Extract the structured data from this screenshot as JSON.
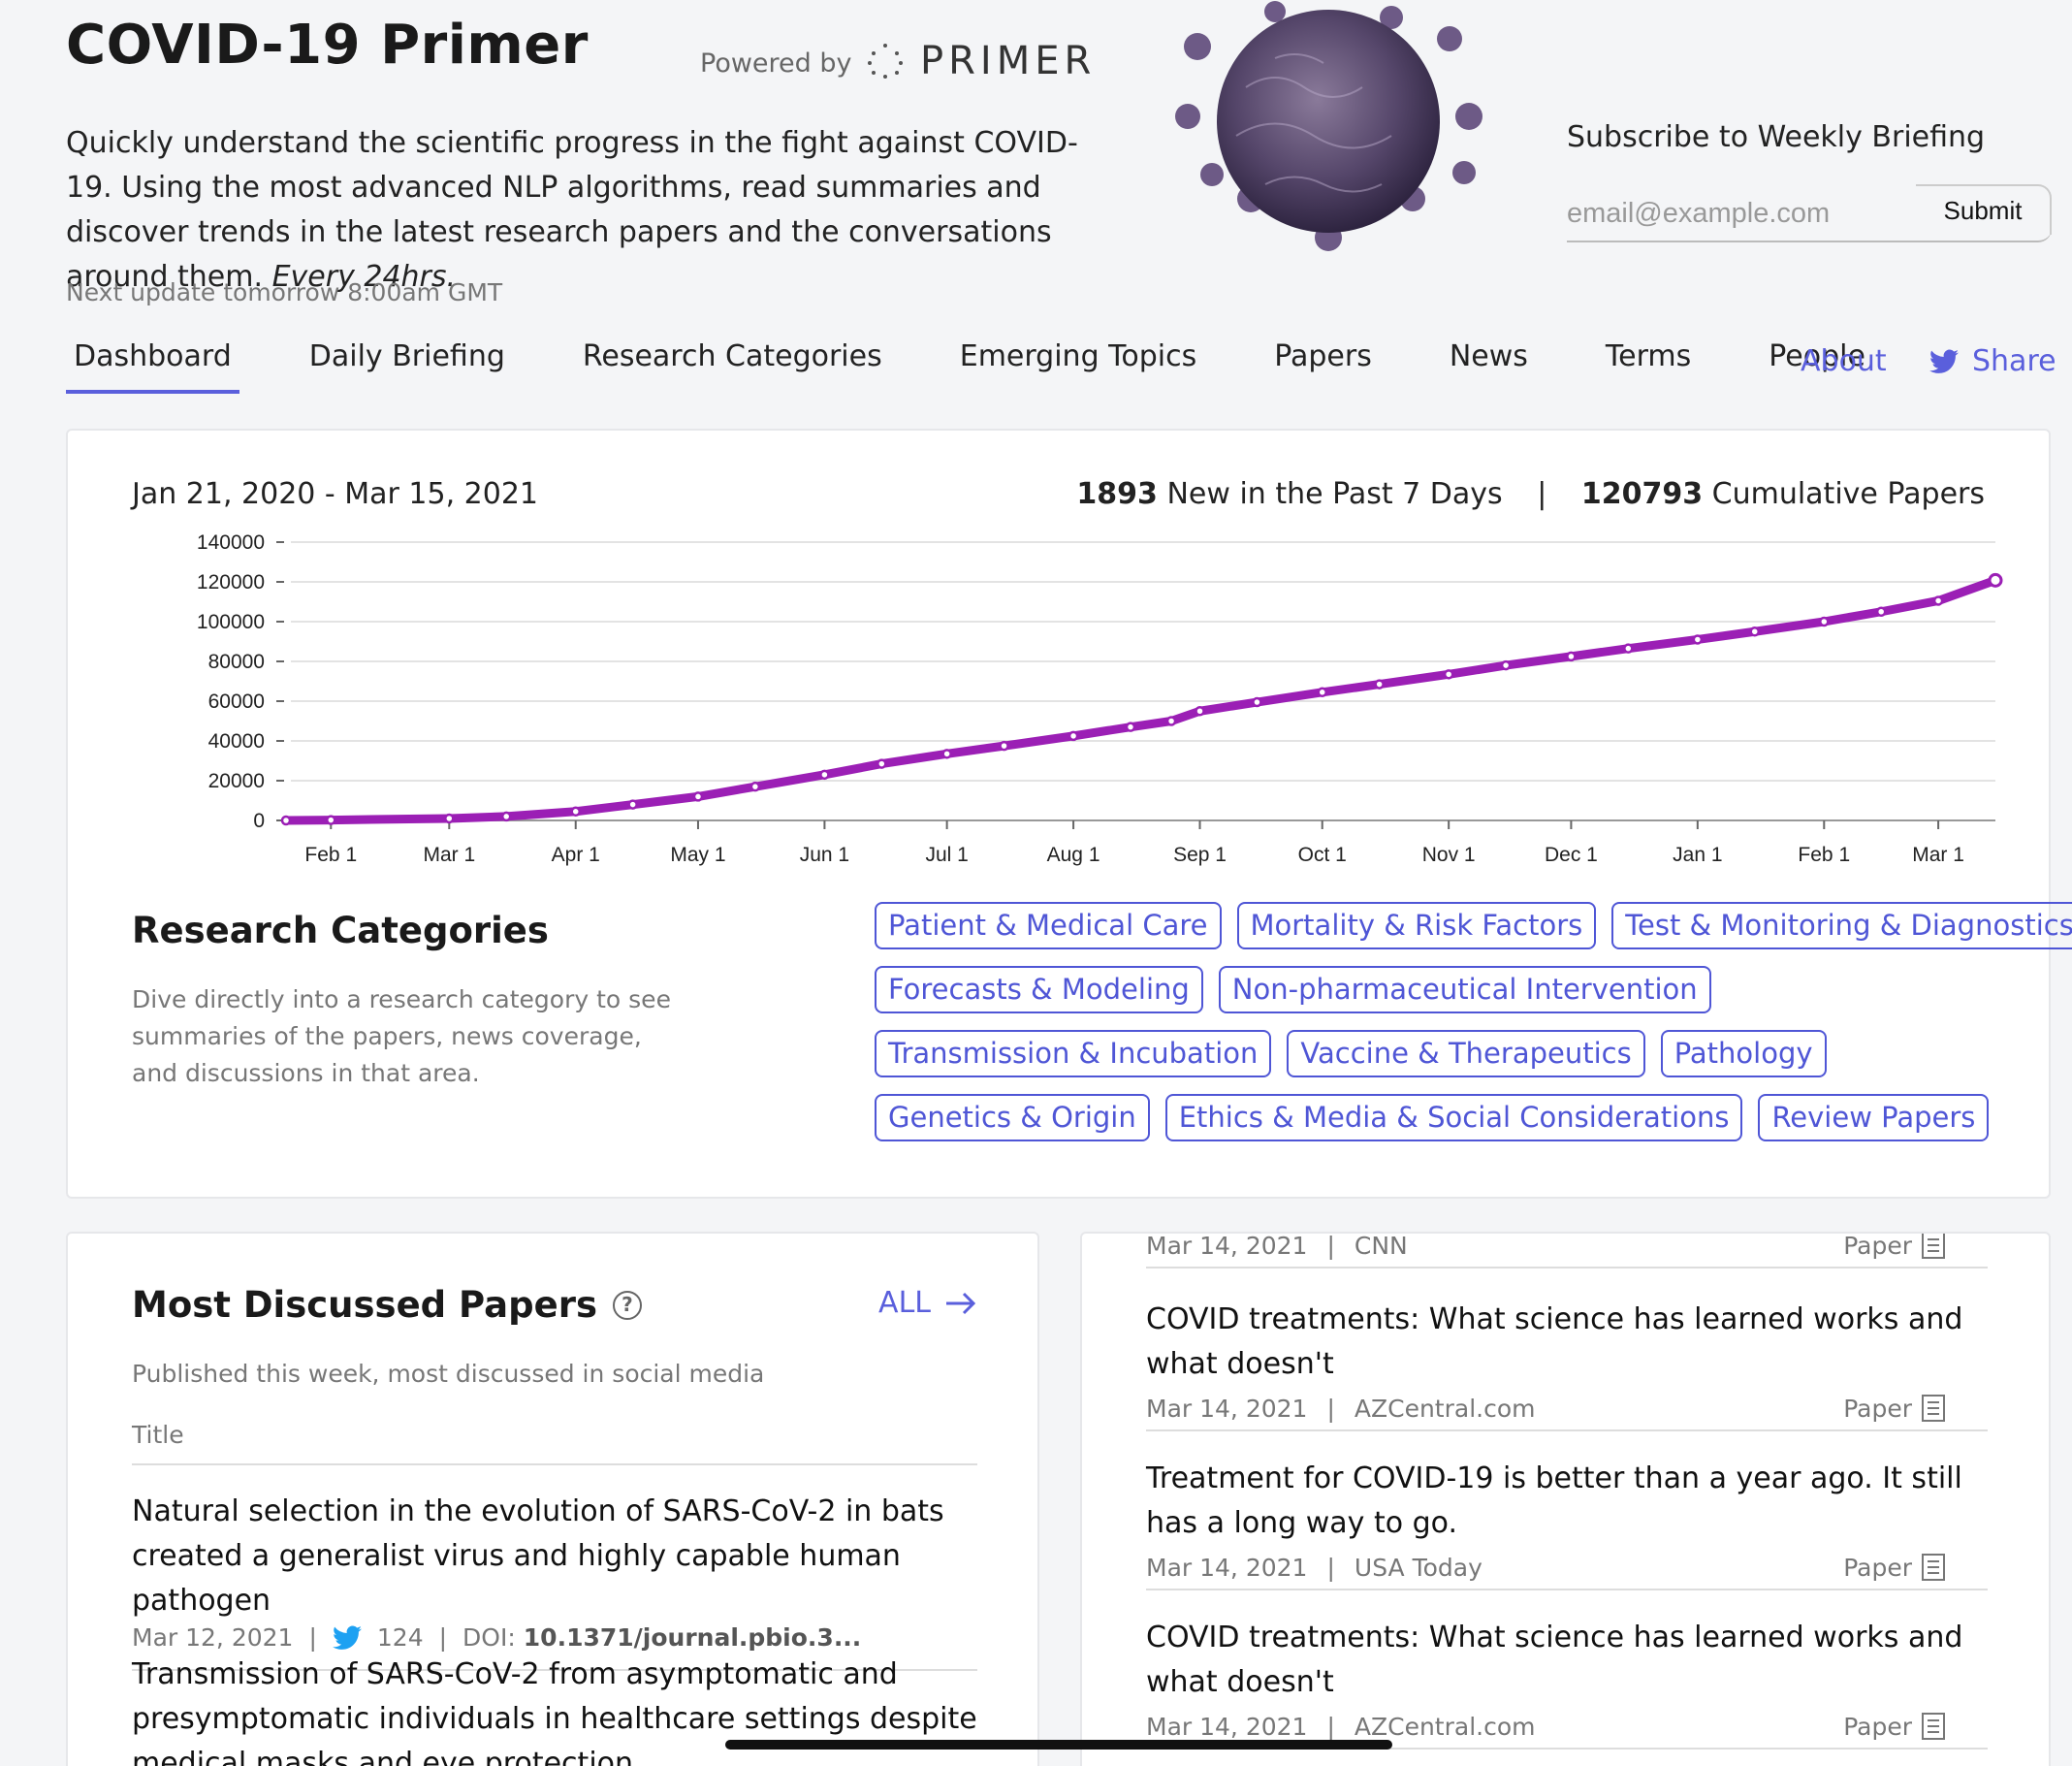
{
  "header": {
    "title": "COVID-19 Primer",
    "powered_by": "Powered by",
    "brand": "PRIMER",
    "intro": "Quickly understand the scientific progress in the fight against COVID-19. Using the most advanced NLP algorithms, read summaries and discover trends in the latest research papers and the conversations around them.",
    "intro_emphasis": "Every 24hrs.",
    "next_update": "Next update tomorrow 8:00am GMT"
  },
  "subscribe": {
    "label": "Subscribe to Weekly Briefing",
    "placeholder": "email@example.com",
    "submit": "Submit"
  },
  "nav": {
    "items": [
      "Dashboard",
      "Daily Briefing",
      "Research Categories",
      "Emerging Topics",
      "Papers",
      "News",
      "Terms",
      "People"
    ],
    "active": "Dashboard",
    "about": "About",
    "share": "Share"
  },
  "dashboard": {
    "date_range": "Jan 21, 2020 - Mar 15, 2021",
    "new_count": "1893",
    "new_label": "New in the Past 7 Days",
    "separator": "|",
    "cumulative_count": "120793",
    "cumulative_label": "Cumulative Papers"
  },
  "chart_data": {
    "type": "line",
    "title": "",
    "xlabel": "",
    "ylabel": "",
    "x_ticks": [
      "Feb 1",
      "Mar 1",
      "Apr 1",
      "May 1",
      "Jun 1",
      "Jul 1",
      "Aug 1",
      "Sep 1",
      "Oct 1",
      "Nov 1",
      "Dec 1",
      "Jan 1",
      "Feb 1",
      "Mar 1"
    ],
    "y_ticks": [
      0,
      20000,
      40000,
      60000,
      80000,
      100000,
      120000,
      140000
    ],
    "ylim": [
      0,
      140000
    ],
    "x_start": "2020-01-21",
    "x_end": "2021-03-15",
    "color": "#9b1fb5",
    "series": [
      {
        "x": [
          "2020-01-21",
          "2020-02-01",
          "2020-03-01",
          "2020-03-15",
          "2020-04-01",
          "2020-04-15",
          "2020-05-01",
          "2020-05-15",
          "2020-06-01",
          "2020-06-15",
          "2020-07-01",
          "2020-07-15",
          "2020-08-01",
          "2020-08-15",
          "2020-08-25",
          "2020-09-01",
          "2020-09-15",
          "2020-10-01",
          "2020-10-15",
          "2020-11-01",
          "2020-11-15",
          "2020-12-01",
          "2020-12-15",
          "2021-01-01",
          "2021-01-15",
          "2021-02-01",
          "2021-02-15",
          "2021-03-01",
          "2021-03-15"
        ],
        "values": [
          0,
          200,
          1000,
          2000,
          4500,
          8000,
          12000,
          17000,
          23000,
          28500,
          33500,
          37500,
          42500,
          47000,
          50000,
          55000,
          59500,
          64500,
          68500,
          73500,
          78000,
          82500,
          86500,
          91000,
          95000,
          100000,
          105000,
          110500,
          120793
        ]
      }
    ]
  },
  "research_categories": {
    "title": "Research Categories",
    "description": "Dive directly into a research category to see summaries of the papers, news coverage, and discussions in that area.",
    "rows": [
      [
        "Patient & Medical Care",
        "Mortality & Risk Factors",
        "Test & Monitoring & Diagnostics"
      ],
      [
        "Forecasts & Modeling",
        "Non-pharmaceutical Intervention"
      ],
      [
        "Transmission & Incubation",
        "Vaccine & Therapeutics",
        "Pathology"
      ],
      [
        "Genetics & Origin",
        "Ethics & Media & Social Considerations",
        "Review Papers"
      ]
    ]
  },
  "most_discussed": {
    "title": "Most Discussed Papers",
    "all_label": "ALL",
    "subtitle": "Published this week, most discussed in social media",
    "column_title": "Title",
    "papers": [
      {
        "title": "Natural selection in the evolution of SARS-CoV-2 in bats created a generalist virus and highly capable human pathogen",
        "date": "Mar 12, 2021",
        "tweets": "124",
        "doi_label": "DOI:",
        "doi": "10.1371/journal.pbio.3..."
      },
      {
        "title": "Transmission of SARS-CoV-2 from asymptomatic and presymptomatic individuals in healthcare settings despite medical masks and eye protection"
      }
    ]
  },
  "news": {
    "items": [
      {
        "title": "",
        "date": "Mar 14, 2021",
        "source": "CNN",
        "tag": "Paper"
      },
      {
        "title": "COVID treatments: What science has learned works and what doesn't",
        "date": "Mar 14, 2021",
        "source": "AZCentral.com",
        "tag": "Paper"
      },
      {
        "title": "Treatment for COVID-19 is better than a year ago. It still has a long way to go.",
        "date": "Mar 14, 2021",
        "source": "USA Today",
        "tag": "Paper"
      },
      {
        "title": "COVID treatments: What science has learned works and what doesn't",
        "date": "Mar 14, 2021",
        "source": "AZCentral.com",
        "tag": "Paper"
      }
    ]
  },
  "colors": {
    "accent": "#5a5fdc",
    "line": "#9b1fb5",
    "twitter": "#1da1f2"
  }
}
